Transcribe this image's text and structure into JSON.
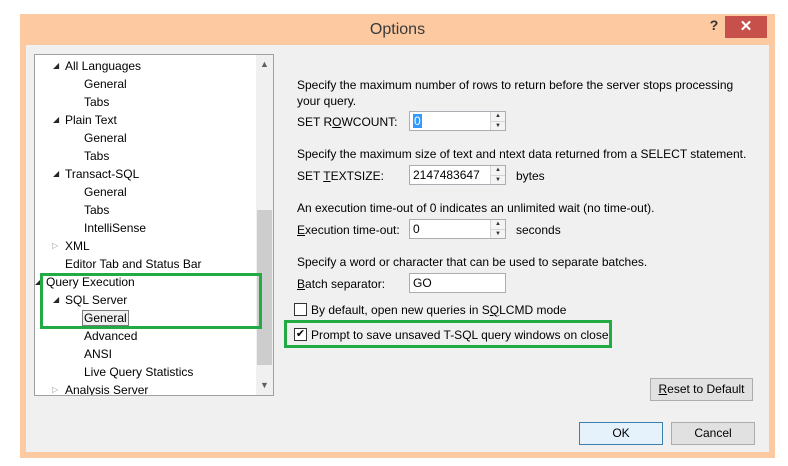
{
  "window": {
    "title": "Options",
    "help_label": "?",
    "close_label": "✕"
  },
  "tree": {
    "items": [
      {
        "label": "All Languages",
        "arrow": "◢"
      },
      {
        "label": "General"
      },
      {
        "label": "Tabs"
      },
      {
        "label": "Plain Text",
        "arrow": "◢"
      },
      {
        "label": "General"
      },
      {
        "label": "Tabs"
      },
      {
        "label": "Transact-SQL",
        "arrow": "◢"
      },
      {
        "label": "General"
      },
      {
        "label": "Tabs"
      },
      {
        "label": "IntelliSense"
      },
      {
        "label": "XML",
        "arrow": "▷"
      },
      {
        "label": "Editor Tab and Status Bar"
      },
      {
        "label": "Query Execution",
        "arrow": "◢"
      },
      {
        "label": "SQL Server",
        "arrow": "◢"
      },
      {
        "label": "General"
      },
      {
        "label": "Advanced"
      },
      {
        "label": "ANSI"
      },
      {
        "label": "Live Query Statistics"
      },
      {
        "label": "Analysis Server",
        "arrow": "▷"
      }
    ],
    "scroll_up": "▲",
    "scroll_down": "▼"
  },
  "settings": {
    "rowcount_desc": "Specify the maximum number of rows to return before the server stops processing your query.",
    "rowcount_label_pre": "SET R",
    "rowcount_label_u": "O",
    "rowcount_label_post": "WCOUNT:",
    "rowcount_value": "0",
    "textsize_desc": "Specify the maximum size of text and ntext data returned from a SELECT statement.",
    "textsize_label_pre": "SET ",
    "textsize_label_u": "T",
    "textsize_label_post": "EXTSIZE:",
    "textsize_value": "2147483647",
    "textsize_unit": "bytes",
    "timeout_desc": "An execution time-out of 0 indicates an unlimited wait (no time-out).",
    "timeout_label_u": "E",
    "timeout_label_post": "xecution time-out:",
    "timeout_value": "0",
    "timeout_unit": "seconds",
    "batch_desc": "Specify a word or character that can be used to separate batches.",
    "batch_label_u": "B",
    "batch_label_post": "atch separator:",
    "batch_value": "GO",
    "sqlcmd_label_pre": "By default, open new queries in S",
    "sqlcmd_label_u": "Q",
    "sqlcmd_label_post": "LCMD mode",
    "sqlcmd_checked": false,
    "prompt_label": "Prompt to save unsaved T-SQL query windows on close",
    "prompt_checked": true,
    "check_glyph": "✔"
  },
  "buttons": {
    "reset_u": "R",
    "reset_post": "eset to Default",
    "ok": "OK",
    "cancel": "Cancel"
  },
  "colors": {
    "highlight": "#22aa44",
    "title_bg": "#fcc9a0",
    "close_bg": "#c7504b"
  }
}
